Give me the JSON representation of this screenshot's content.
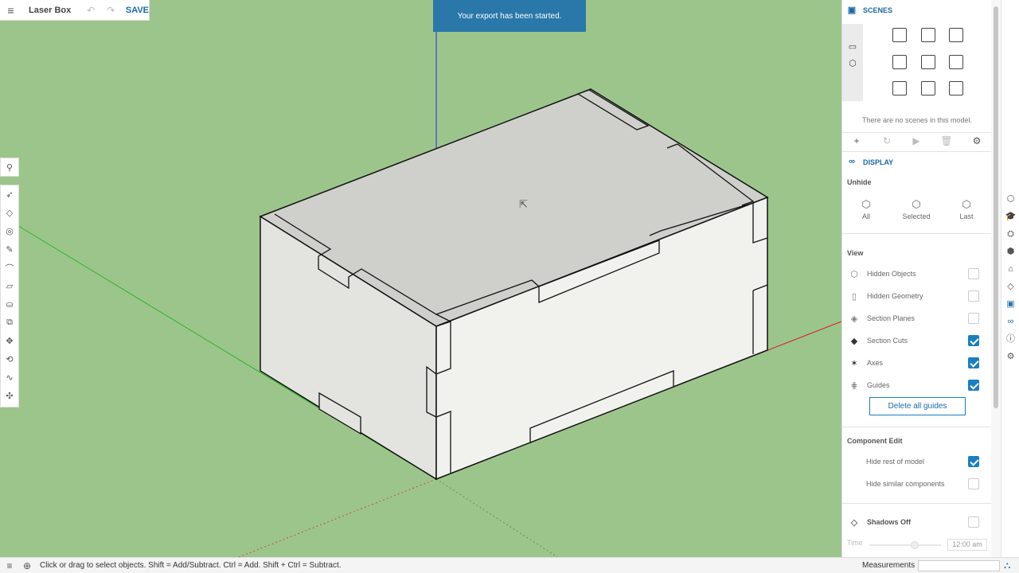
{
  "app": {
    "model_title": "Laser Box",
    "save_label": "SAVE"
  },
  "toast": {
    "message": "Your export has been started."
  },
  "status": {
    "hint": "Click or drag to select objects. Shift = Add/Subtract. Ctrl = Add. Shift + Ctrl = Subtract.",
    "measurements_label": "Measurements",
    "measurements_value": ""
  },
  "scenes": {
    "header": "SCENES",
    "empty_message": "There are no scenes in this model."
  },
  "display": {
    "header": "DISPLAY",
    "unhide_title": "Unhide",
    "unhide_items": [
      "All",
      "Selected",
      "Last"
    ],
    "view_title": "View",
    "view_items": [
      {
        "label": "Hidden Objects",
        "checked": false
      },
      {
        "label": "Hidden Geometry",
        "checked": false
      },
      {
        "label": "Section Planes",
        "checked": false
      },
      {
        "label": "Section Cuts",
        "checked": true
      },
      {
        "label": "Axes",
        "checked": true
      },
      {
        "label": "Guides",
        "checked": true
      }
    ],
    "delete_guides_label": "Delete all guides",
    "component_edit_title": "Component Edit",
    "component_edit_items": [
      {
        "label": "Hide rest of model",
        "checked": true
      },
      {
        "label": "Hide similar components",
        "checked": false
      }
    ],
    "shadows_label": "Shadows Off",
    "shadows_checked": false,
    "time_label": "Time",
    "time_value": "12:00 am"
  },
  "colors": {
    "accent": "#1a7fbf",
    "viewport_bg": "#9cc58c",
    "toast_bg": "#2a77a9"
  }
}
